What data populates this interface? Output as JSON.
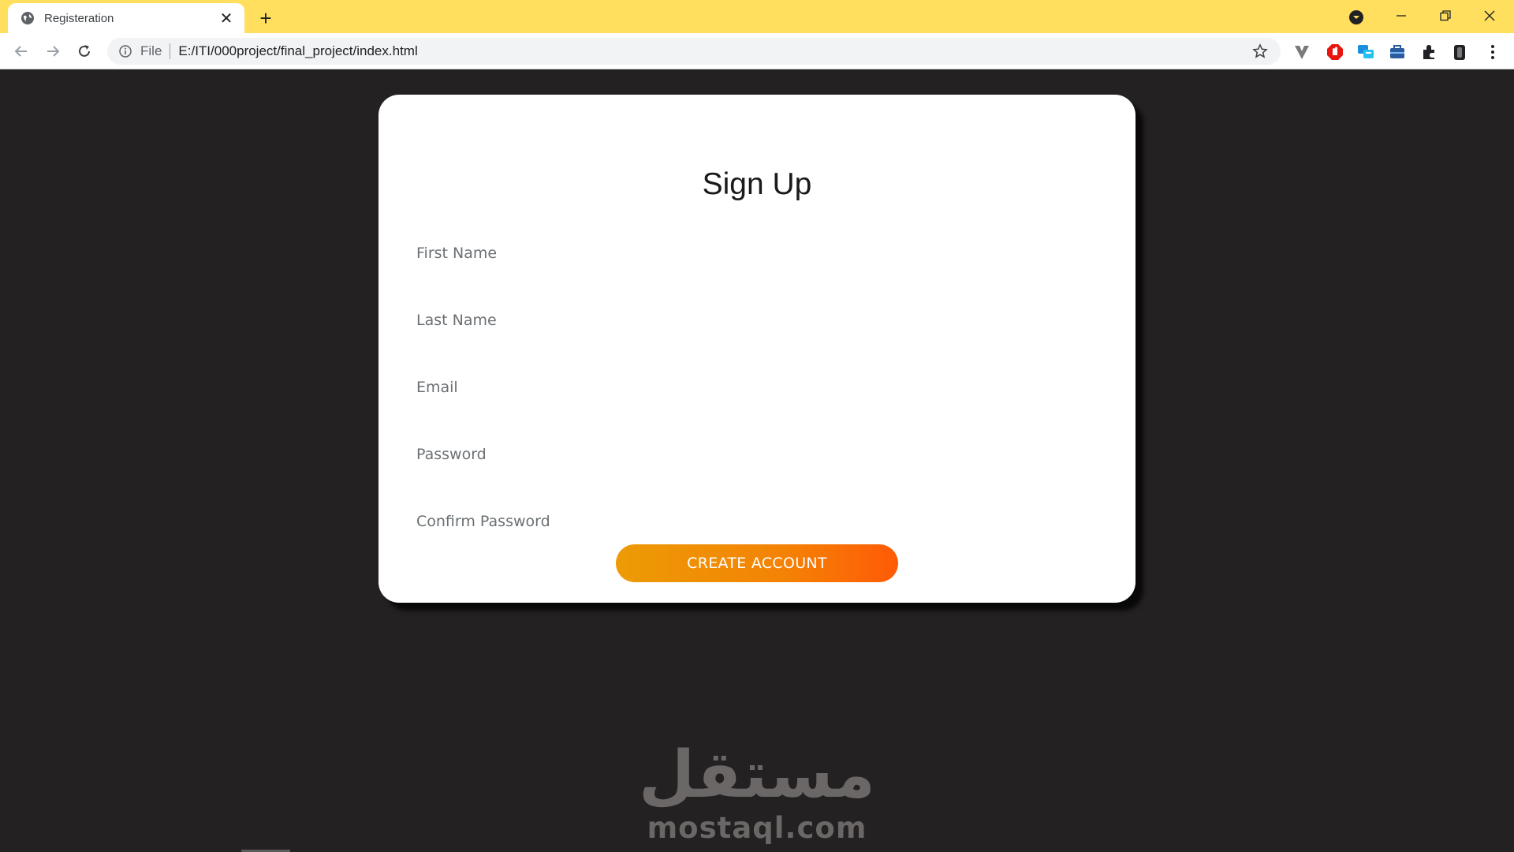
{
  "browser": {
    "tab_title": "Registeration",
    "tab_close": "✕",
    "new_tab": "+",
    "scheme_label": "File",
    "url": "E:/ITI/000project/final_project/index.html",
    "accent_color": "#ffdf5d"
  },
  "form": {
    "title": "Sign Up",
    "fields": [
      {
        "placeholder": "First Name"
      },
      {
        "placeholder": "Last Name"
      },
      {
        "placeholder": "Email"
      },
      {
        "placeholder": "Password"
      },
      {
        "placeholder": "Confirm Password"
      }
    ],
    "submit_label": "CREATE ACCOUNT",
    "button_gradient": [
      "#ec9b05",
      "#ff5a06"
    ]
  },
  "watermark": {
    "arabic": "مستقل",
    "latin": "mostaql.com"
  }
}
